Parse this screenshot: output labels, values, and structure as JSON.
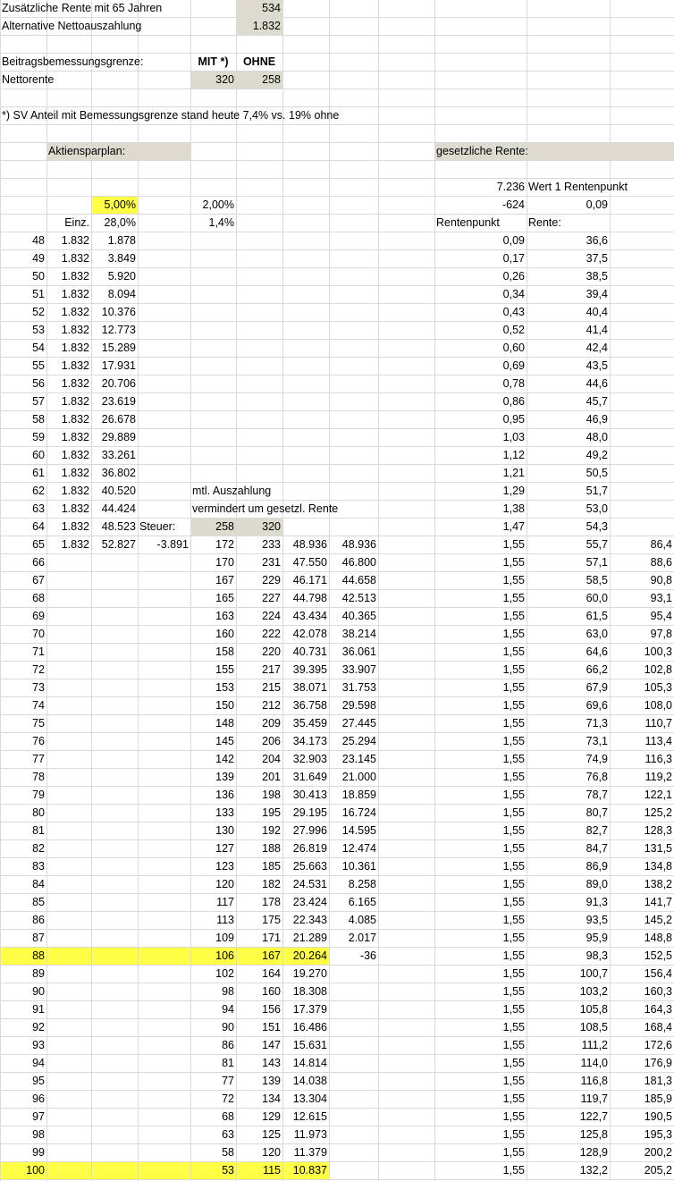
{
  "colors": {
    "tan": "#dddad0",
    "highlight_yellow": "#ffff45",
    "gridline": "#d9d9d9"
  },
  "top": {
    "zusatz_label": "Zusätzliche Rente mit 65 Jahren",
    "zusatz_value": "534",
    "alt_label": "Alternative Nettoauszahlung",
    "alt_value": "1.832",
    "bbg_label": "Beitragsbemessungsgrenze:",
    "mit_header": "MIT *)",
    "ohne_header": "OHNE",
    "nettorente_label": "Nettorente",
    "nettorente_mit": "320",
    "nettorente_ohne": "258",
    "footnote": "*) SV Anteil mit Bemessungsgrenze stand heute 7,4% vs. 19% ohne"
  },
  "aktien": {
    "title": "Aktiensparplan:",
    "rate": "5,00%",
    "rate2": "2,00%",
    "einz_label": "Einz.",
    "tax_rate": "28,0%",
    "rate3": "1,4%",
    "mtl_label": "mtl. Auszahlung",
    "vermindert_label": "vermindert um gesetzl. Rente",
    "steuer_label": "Steuer:",
    "steuer_mit": "258",
    "steuer_ohne": "320"
  },
  "rente": {
    "title": "gesetzliche Rente:",
    "wert_amount": "7.236",
    "wert_label": "Wert 1 Rentenpunkt",
    "neg_value": "-624",
    "punkt_value": "0,09",
    "rentenpunkt_header": "Rentenpunkt",
    "rente_header": "Rente:"
  },
  "rows": [
    {
      "age": "48",
      "einz": "1.832",
      "kap": "1.878",
      "rp": "0,09",
      "rente": "36,6"
    },
    {
      "age": "49",
      "einz": "1.832",
      "kap": "3.849",
      "rp": "0,17",
      "rente": "37,5"
    },
    {
      "age": "50",
      "einz": "1.832",
      "kap": "5.920",
      "rp": "0,26",
      "rente": "38,5"
    },
    {
      "age": "51",
      "einz": "1.832",
      "kap": "8.094",
      "rp": "0,34",
      "rente": "39,4"
    },
    {
      "age": "52",
      "einz": "1.832",
      "kap": "10.376",
      "rp": "0,43",
      "rente": "40,4"
    },
    {
      "age": "53",
      "einz": "1.832",
      "kap": "12.773",
      "rp": "0,52",
      "rente": "41,4"
    },
    {
      "age": "54",
      "einz": "1.832",
      "kap": "15.289",
      "rp": "0,60",
      "rente": "42,4"
    },
    {
      "age": "55",
      "einz": "1.832",
      "kap": "17.931",
      "rp": "0,69",
      "rente": "43,5"
    },
    {
      "age": "56",
      "einz": "1.832",
      "kap": "20.706",
      "rp": "0,78",
      "rente": "44,6"
    },
    {
      "age": "57",
      "einz": "1.832",
      "kap": "23.619",
      "rp": "0,86",
      "rente": "45,7"
    },
    {
      "age": "58",
      "einz": "1.832",
      "kap": "26.678",
      "rp": "0,95",
      "rente": "46,9"
    },
    {
      "age": "59",
      "einz": "1.832",
      "kap": "29.889",
      "rp": "1,03",
      "rente": "48,0"
    },
    {
      "age": "60",
      "einz": "1.832",
      "kap": "33.261",
      "rp": "1,12",
      "rente": "49,2"
    },
    {
      "age": "61",
      "einz": "1.832",
      "kap": "36.802",
      "rp": "1,21",
      "rente": "50,5"
    },
    {
      "age": "62",
      "einz": "1.832",
      "kap": "40.520",
      "rp": "1,29",
      "rente": "51,7"
    },
    {
      "age": "63",
      "einz": "1.832",
      "kap": "44.424",
      "rp": "1,38",
      "rente": "53,0"
    },
    {
      "age": "64",
      "einz": "1.832",
      "kap": "48.523",
      "rp": "1,47",
      "rente": "54,3"
    },
    {
      "age": "65",
      "einz": "1.832",
      "kap": "52.827",
      "steuer": "-3.891",
      "mtl_mit": "172",
      "mtl_ohne": "233",
      "kap_mit": "48.936",
      "kap_ohne": "48.936",
      "rp": "1,55",
      "rente": "55,7",
      "last": "86,4"
    },
    {
      "age": "66",
      "mtl_mit": "170",
      "mtl_ohne": "231",
      "kap_mit": "47.550",
      "kap_ohne": "46.800",
      "rp": "1,55",
      "rente": "57,1",
      "last": "88,6"
    },
    {
      "age": "67",
      "mtl_mit": "167",
      "mtl_ohne": "229",
      "kap_mit": "46.171",
      "kap_ohne": "44.658",
      "rp": "1,55",
      "rente": "58,5",
      "last": "90,8"
    },
    {
      "age": "68",
      "mtl_mit": "165",
      "mtl_ohne": "227",
      "kap_mit": "44.798",
      "kap_ohne": "42.513",
      "rp": "1,55",
      "rente": "60,0",
      "last": "93,1"
    },
    {
      "age": "69",
      "mtl_mit": "163",
      "mtl_ohne": "224",
      "kap_mit": "43.434",
      "kap_ohne": "40.365",
      "rp": "1,55",
      "rente": "61,5",
      "last": "95,4"
    },
    {
      "age": "70",
      "mtl_mit": "160",
      "mtl_ohne": "222",
      "kap_mit": "42.078",
      "kap_ohne": "38.214",
      "rp": "1,55",
      "rente": "63,0",
      "last": "97,8"
    },
    {
      "age": "71",
      "mtl_mit": "158",
      "mtl_ohne": "220",
      "kap_mit": "40.731",
      "kap_ohne": "36.061",
      "rp": "1,55",
      "rente": "64,6",
      "last": "100,3"
    },
    {
      "age": "72",
      "mtl_mit": "155",
      "mtl_ohne": "217",
      "kap_mit": "39.395",
      "kap_ohne": "33.907",
      "rp": "1,55",
      "rente": "66,2",
      "last": "102,8"
    },
    {
      "age": "73",
      "mtl_mit": "153",
      "mtl_ohne": "215",
      "kap_mit": "38.071",
      "kap_ohne": "31.753",
      "rp": "1,55",
      "rente": "67,9",
      "last": "105,3"
    },
    {
      "age": "74",
      "mtl_mit": "150",
      "mtl_ohne": "212",
      "kap_mit": "36.758",
      "kap_ohne": "29.598",
      "rp": "1,55",
      "rente": "69,6",
      "last": "108,0"
    },
    {
      "age": "75",
      "mtl_mit": "148",
      "mtl_ohne": "209",
      "kap_mit": "35.459",
      "kap_ohne": "27.445",
      "rp": "1,55",
      "rente": "71,3",
      "last": "110,7"
    },
    {
      "age": "76",
      "mtl_mit": "145",
      "mtl_ohne": "206",
      "kap_mit": "34.173",
      "kap_ohne": "25.294",
      "rp": "1,55",
      "rente": "73,1",
      "last": "113,4"
    },
    {
      "age": "77",
      "mtl_mit": "142",
      "mtl_ohne": "204",
      "kap_mit": "32.903",
      "kap_ohne": "23.145",
      "rp": "1,55",
      "rente": "74,9",
      "last": "116,3"
    },
    {
      "age": "78",
      "mtl_mit": "139",
      "mtl_ohne": "201",
      "kap_mit": "31.649",
      "kap_ohne": "21.000",
      "rp": "1,55",
      "rente": "76,8",
      "last": "119,2"
    },
    {
      "age": "79",
      "mtl_mit": "136",
      "mtl_ohne": "198",
      "kap_mit": "30.413",
      "kap_ohne": "18.859",
      "rp": "1,55",
      "rente": "78,7",
      "last": "122,1"
    },
    {
      "age": "80",
      "mtl_mit": "133",
      "mtl_ohne": "195",
      "kap_mit": "29.195",
      "kap_ohne": "16.724",
      "rp": "1,55",
      "rente": "80,7",
      "last": "125,2"
    },
    {
      "age": "81",
      "mtl_mit": "130",
      "mtl_ohne": "192",
      "kap_mit": "27.996",
      "kap_ohne": "14.595",
      "rp": "1,55",
      "rente": "82,7",
      "last": "128,3"
    },
    {
      "age": "82",
      "mtl_mit": "127",
      "mtl_ohne": "188",
      "kap_mit": "26.819",
      "kap_ohne": "12.474",
      "rp": "1,55",
      "rente": "84,7",
      "last": "131,5"
    },
    {
      "age": "83",
      "mtl_mit": "123",
      "mtl_ohne": "185",
      "kap_mit": "25.663",
      "kap_ohne": "10.361",
      "rp": "1,55",
      "rente": "86,9",
      "last": "134,8"
    },
    {
      "age": "84",
      "mtl_mit": "120",
      "mtl_ohne": "182",
      "kap_mit": "24.531",
      "kap_ohne": "8.258",
      "rp": "1,55",
      "rente": "89,0",
      "last": "138,2"
    },
    {
      "age": "85",
      "mtl_mit": "117",
      "mtl_ohne": "178",
      "kap_mit": "23.424",
      "kap_ohne": "6.165",
      "rp": "1,55",
      "rente": "91,3",
      "last": "141,7"
    },
    {
      "age": "86",
      "mtl_mit": "113",
      "mtl_ohne": "175",
      "kap_mit": "22.343",
      "kap_ohne": "4.085",
      "rp": "1,55",
      "rente": "93,5",
      "last": "145,2"
    },
    {
      "age": "87",
      "mtl_mit": "109",
      "mtl_ohne": "171",
      "kap_mit": "21.289",
      "kap_ohne": "2.017",
      "rp": "1,55",
      "rente": "95,9",
      "last": "148,8"
    },
    {
      "age": "88",
      "mtl_mit": "106",
      "mtl_ohne": "167",
      "kap_mit": "20.264",
      "kap_ohne": "-36",
      "rp": "1,55",
      "rente": "98,3",
      "last": "152,5",
      "hl": true
    },
    {
      "age": "89",
      "mtl_mit": "102",
      "mtl_ohne": "164",
      "kap_mit": "19.270",
      "rp": "1,55",
      "rente": "100,7",
      "last": "156,4"
    },
    {
      "age": "90",
      "mtl_mit": "98",
      "mtl_ohne": "160",
      "kap_mit": "18.308",
      "rp": "1,55",
      "rente": "103,2",
      "last": "160,3"
    },
    {
      "age": "91",
      "mtl_mit": "94",
      "mtl_ohne": "156",
      "kap_mit": "17.379",
      "rp": "1,55",
      "rente": "105,8",
      "last": "164,3"
    },
    {
      "age": "92",
      "mtl_mit": "90",
      "mtl_ohne": "151",
      "kap_mit": "16.486",
      "rp": "1,55",
      "rente": "108,5",
      "last": "168,4"
    },
    {
      "age": "93",
      "mtl_mit": "86",
      "mtl_ohne": "147",
      "kap_mit": "15.631",
      "rp": "1,55",
      "rente": "111,2",
      "last": "172,6"
    },
    {
      "age": "94",
      "mtl_mit": "81",
      "mtl_ohne": "143",
      "kap_mit": "14.814",
      "rp": "1,55",
      "rente": "114,0",
      "last": "176,9"
    },
    {
      "age": "95",
      "mtl_mit": "77",
      "mtl_ohne": "139",
      "kap_mit": "14.038",
      "rp": "1,55",
      "rente": "116,8",
      "last": "181,3"
    },
    {
      "age": "96",
      "mtl_mit": "72",
      "mtl_ohne": "134",
      "kap_mit": "13.304",
      "rp": "1,55",
      "rente": "119,7",
      "last": "185,9"
    },
    {
      "age": "97",
      "mtl_mit": "68",
      "mtl_ohne": "129",
      "kap_mit": "12.615",
      "rp": "1,55",
      "rente": "122,7",
      "last": "190,5"
    },
    {
      "age": "98",
      "mtl_mit": "63",
      "mtl_ohne": "125",
      "kap_mit": "11.973",
      "rp": "1,55",
      "rente": "125,8",
      "last": "195,3"
    },
    {
      "age": "99",
      "mtl_mit": "58",
      "mtl_ohne": "120",
      "kap_mit": "11.379",
      "rp": "1,55",
      "rente": "128,9",
      "last": "200,2"
    },
    {
      "age": "100",
      "mtl_mit": "53",
      "mtl_ohne": "115",
      "kap_mit": "10.837",
      "rp": "1,55",
      "rente": "132,2",
      "last": "205,2",
      "hl": true
    }
  ]
}
